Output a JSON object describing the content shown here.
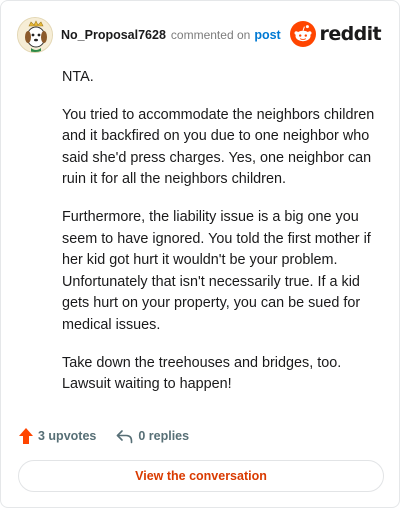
{
  "header": {
    "username": "No_Proposal7628",
    "action_text": "commented on",
    "post_link": "post",
    "brand_word": "reddit"
  },
  "comment": {
    "paragraphs": [
      "NTA.",
      "You tried to accommodate the neighbors children and it backfired on you due to one neighbor who said she'd press charges. Yes, one neighbor can ruin it for all the neighbors children.",
      "Furthermore, the liability issue is a big one you seem to have ignored. You told the first mother if her kid got hurt it wouldn't be your problem. Unfortunately that isn't necessarily true. If a kid gets hurt on your property, you can be sued for medical issues.",
      "Take down the treehouses and bridges, too. Lawsuit waiting to happen!"
    ]
  },
  "footer": {
    "upvotes": "3 upvotes",
    "replies": "0 replies",
    "cta": "View the conversation"
  },
  "colors": {
    "accent": "#d93a00",
    "link": "#0079d3",
    "upvote": "#ff4500",
    "muted": "#576f76"
  },
  "icons": {
    "avatar": "avatar-icon",
    "brand": "reddit-logo-icon",
    "upvote": "upvote-arrow-icon",
    "reply": "reply-arrow-icon"
  }
}
